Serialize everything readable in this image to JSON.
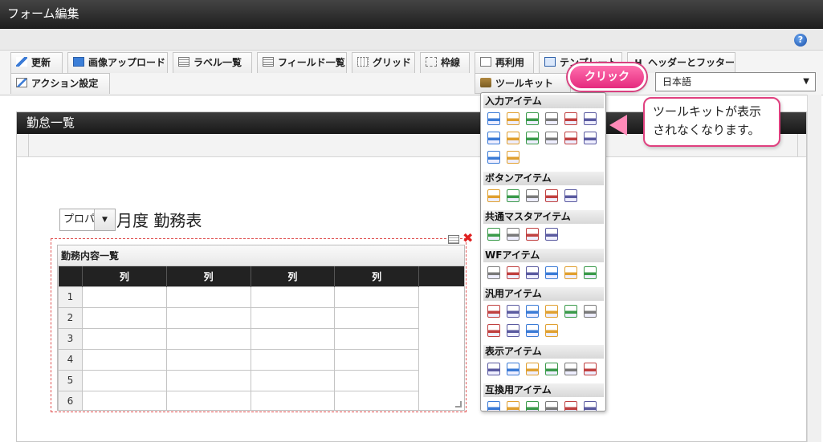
{
  "window": {
    "title": "フォーム編集"
  },
  "help_label": "?",
  "toolbar": {
    "buttons": [
      {
        "label": "更新"
      },
      {
        "label": "画像アップロード"
      },
      {
        "label": "ラベル一覧"
      },
      {
        "label": "フィールド一覧"
      },
      {
        "label": "グリッド"
      },
      {
        "label": "枠線"
      },
      {
        "label": "再利用"
      },
      {
        "label": "テンプレート"
      },
      {
        "label": "ヘッダーとフッター"
      },
      {
        "label": "アクション設定"
      },
      {
        "label": "ツールキット"
      }
    ],
    "language": {
      "selected": "日本語"
    },
    "header_mark": "H"
  },
  "canvas": {
    "title": "勤怠一覧",
    "select_value": "プロパ",
    "heading": "月度 勤務表"
  },
  "grid": {
    "title": "勤務内容一覧",
    "columns": [
      "列",
      "列",
      "列",
      "列"
    ],
    "rows": [
      "1",
      "2",
      "3",
      "4",
      "5",
      "6"
    ]
  },
  "toolkit": {
    "categories": [
      {
        "label": "入力アイテム",
        "icons": [
          "text-field-icon",
          "textarea-icon",
          "number-field-icon",
          "formula-icon",
          "date-icon",
          "datetime-icon",
          "combo-icon",
          "list-icon",
          "checkbox-icon",
          "radio-icon",
          "select-list-icon",
          "select-box-icon",
          "upload-icon",
          "grid-table-icon"
        ]
      },
      {
        "label": "ボタンアイテム",
        "icons": [
          "register-button-icon",
          "next-button-icon",
          "back-button-icon",
          "prev-button-icon",
          "forward-button-icon"
        ]
      },
      {
        "label": "共通マスタアイテム",
        "icons": [
          "user-icon",
          "department-icon",
          "role-icon",
          "public-group-icon"
        ]
      },
      {
        "label": "WFアイテム",
        "icons": [
          "matter-icon",
          "attachment-icon",
          "image-icon",
          "history-icon",
          "approver-icon",
          "stamp-icon"
        ]
      },
      {
        "label": "汎用アイテム",
        "icons": [
          "hidden-icon",
          "document-icon",
          "camera-icon",
          "search-icon",
          "upload-file-icon",
          "download-icon",
          "file-icon",
          "image-item-icon",
          "tree-icon",
          "calendar-icon"
        ]
      },
      {
        "label": "表示アイテム",
        "icons": [
          "header-bar-icon",
          "horizontal-line-icon",
          "vertical-line-icon",
          "panel-icon",
          "image-display-icon",
          "text-display-icon"
        ]
      },
      {
        "label": "互換用アイテム",
        "icons": [
          "legacy-combo-icon",
          "legacy-list-icon",
          "legacy-checkbox-icon",
          "legacy-radio-icon",
          "legacy-select-icon",
          "legacy-selectbox-icon"
        ]
      }
    ]
  },
  "annotations": {
    "click_label": "クリック",
    "callout_text": [
      "ツールキットが表示",
      "されなくなります。"
    ]
  },
  "colors": {
    "accent_pink": "#e52a7e",
    "titlebar": "#2a2a2a"
  }
}
